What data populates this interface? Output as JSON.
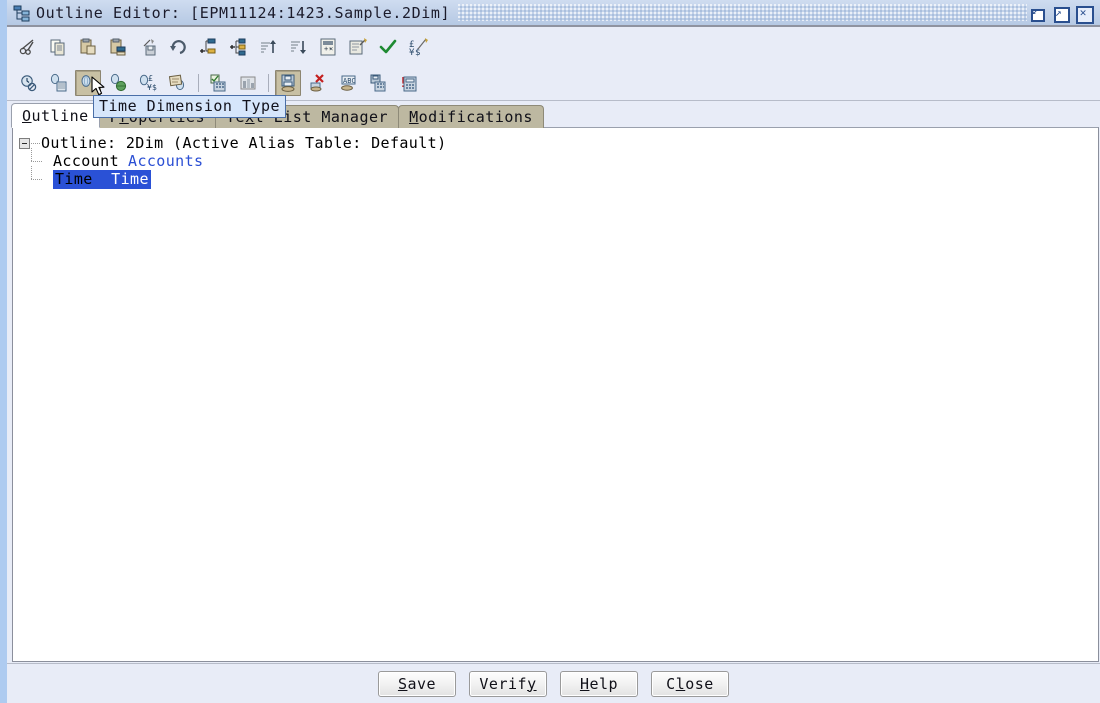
{
  "window": {
    "title": "Outline Editor:  [EPM11124:1423.Sample.2Dim]",
    "icon": "outline-tree-icon",
    "controls": [
      {
        "name": "restore-button",
        "glyph": "restore"
      },
      {
        "name": "maximize-button",
        "glyph": "maximize"
      },
      {
        "name": "close-button",
        "glyph": "close"
      }
    ]
  },
  "toolbar_primary": {
    "buttons": [
      {
        "name": "cut-button",
        "icon": "scissors-icon",
        "tooltip": "Cut"
      },
      {
        "name": "copy-button",
        "icon": "copy-icon",
        "tooltip": "Copy"
      },
      {
        "name": "paste-button",
        "icon": "paste-icon",
        "tooltip": "Paste"
      },
      {
        "name": "paste-child-button",
        "icon": "paste-child-icon",
        "tooltip": "Paste as Child"
      },
      {
        "name": "delete-button",
        "icon": "delete-member-icon",
        "tooltip": "Delete"
      },
      {
        "name": "undo-button",
        "icon": "undo-arrow-icon",
        "tooltip": "Undo"
      },
      {
        "name": "add-sibling-button",
        "icon": "add-sibling-icon",
        "tooltip": "Add Sibling"
      },
      {
        "name": "add-child-button",
        "icon": "add-child-icon",
        "tooltip": "Add Child"
      },
      {
        "name": "sort-ascending-button",
        "icon": "sort-ascending-icon",
        "tooltip": "Sort Ascending"
      },
      {
        "name": "sort-descending-button",
        "icon": "sort-descending-icon",
        "tooltip": "Sort Descending"
      },
      {
        "name": "calc-script-button",
        "icon": "calc-script-icon",
        "tooltip": "Calculation Script"
      },
      {
        "name": "formula-editor-button",
        "icon": "formula-editor-icon",
        "tooltip": "Formula Editor"
      },
      {
        "name": "verify-outline-button",
        "icon": "check-mark-icon",
        "tooltip": "Verify Outline"
      },
      {
        "name": "currency-conversion-button",
        "icon": "currency-icon",
        "tooltip": "Currency Conversion"
      }
    ]
  },
  "toolbar_secondary": {
    "buttons": [
      {
        "name": "no-time-dimension-button",
        "icon": "clock-disabled-icon",
        "pressed": false
      },
      {
        "name": "dimension-properties-button",
        "icon": "dimension-properties-icon",
        "pressed": false
      },
      {
        "name": "time-dimension-type-button",
        "icon": "time-dimension-icon",
        "pressed": true,
        "hovered": true,
        "tooltip": "Time Dimension Type"
      },
      {
        "name": "accounts-dimension-type-button",
        "icon": "accounts-dimension-icon",
        "pressed": false
      },
      {
        "name": "currency-dimension-type-button",
        "icon": "currency-dimension-icon",
        "pressed": false
      },
      {
        "name": "attribute-dimension-type-button",
        "icon": "attribute-dimension-icon",
        "pressed": false
      },
      {
        "name": "dense-storage-button",
        "icon": "dense-storage-icon",
        "pressed": false
      },
      {
        "name": "sparse-storage-button",
        "icon": "sparse-storage-icon",
        "pressed": false
      },
      {
        "name": "store-data-button",
        "icon": "store-data-icon",
        "pressed": true
      },
      {
        "name": "never-share-button",
        "icon": "never-share-icon",
        "pressed": false
      },
      {
        "name": "label-only-button",
        "icon": "label-only-icon",
        "pressed": false
      },
      {
        "name": "shared-member-button",
        "icon": "shared-member-icon",
        "pressed": false
      },
      {
        "name": "dynamic-calc-button",
        "icon": "dynamic-calc-icon",
        "pressed": false
      }
    ]
  },
  "tooltip": {
    "visible": true,
    "text": "Time Dimension Type"
  },
  "tabs": [
    {
      "name": "tab-outline",
      "label": "Outline",
      "mnemonic_index": 0,
      "active": true
    },
    {
      "name": "tab-properties",
      "label": "Properties",
      "mnemonic_index": 1,
      "active": false
    },
    {
      "name": "tab-text-list-manager",
      "label": "Text List Manager",
      "mnemonic_index": 3,
      "active": false
    },
    {
      "name": "tab-modifications",
      "label": "Modifications",
      "mnemonic_index": 0,
      "active": false
    }
  ],
  "outline": {
    "root": {
      "label": "Outline: 2Dim (Active Alias Table: Default)",
      "expanded": true
    },
    "members": [
      {
        "name": "Account",
        "alias": "Accounts",
        "selected": false,
        "last": false
      },
      {
        "name": "Time",
        "alias": "Time",
        "selected": true,
        "last": true
      }
    ]
  },
  "footer": {
    "buttons": [
      {
        "name": "save-button",
        "label": "Save",
        "mnemonic_index": 0
      },
      {
        "name": "verify-button",
        "label": "Verify",
        "mnemonic_index": 5
      },
      {
        "name": "help-button",
        "label": "Help",
        "mnemonic_index": 0
      },
      {
        "name": "close-button-footer",
        "label": "Close",
        "mnemonic_index": 1
      }
    ]
  },
  "colors": {
    "titlebar_start": "#cfdcf0",
    "titlebar_end": "#b6c9e4",
    "panel_bg": "#e8ecf7",
    "content_bg": "#ffffff",
    "tab_inactive": "#bdb8a1",
    "selection": "#2a51d6",
    "alias_text": "#2b4fd4",
    "pressed_button": "#c8c0a4",
    "left_strip": "#aecbf0",
    "tooltip_bg": "#d6e6fb",
    "tooltip_border": "#4a6fa8"
  }
}
